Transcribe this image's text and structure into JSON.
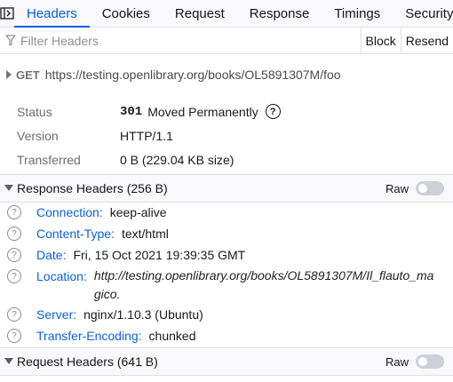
{
  "tabs": [
    "Headers",
    "Cookies",
    "Request",
    "Response",
    "Timings",
    "Security"
  ],
  "filter": {
    "placeholder": "Filter Headers",
    "block_label": "Block",
    "resend_label": "Resend"
  },
  "request": {
    "method": "GET",
    "url": "https://testing.openlibrary.org/books/OL5891307M/foo"
  },
  "summary": {
    "status_label": "Status",
    "status_code": "301",
    "status_text": "Moved Permanently",
    "version_label": "Version",
    "version_value": "HTTP/1.1",
    "transferred_label": "Transferred",
    "transferred_value": "0 B (229.04 KB size)"
  },
  "response_headers": {
    "title": "Response Headers (256 B)",
    "raw_label": "Raw",
    "raw_enabled": false,
    "items": [
      {
        "name": "Connection:",
        "value": "keep-alive"
      },
      {
        "name": "Content-Type:",
        "value": "text/html"
      },
      {
        "name": "Date:",
        "value": "Fri, 15 Oct 2021 19:39:35 GMT"
      },
      {
        "name": "Location:",
        "value": "http://testing.openlibrary.org/books/OL5891307M/Il_flauto_magico."
      },
      {
        "name": "Server:",
        "value": "nginx/1.10.3 (Ubuntu)"
      },
      {
        "name": "Transfer-Encoding:",
        "value": "chunked"
      }
    ]
  },
  "request_headers": {
    "title": "Request Headers (641 B)",
    "raw_label": "Raw",
    "raw_enabled": false
  },
  "colors": {
    "accent": "#0061e0",
    "header_name": "#0b62d6"
  }
}
